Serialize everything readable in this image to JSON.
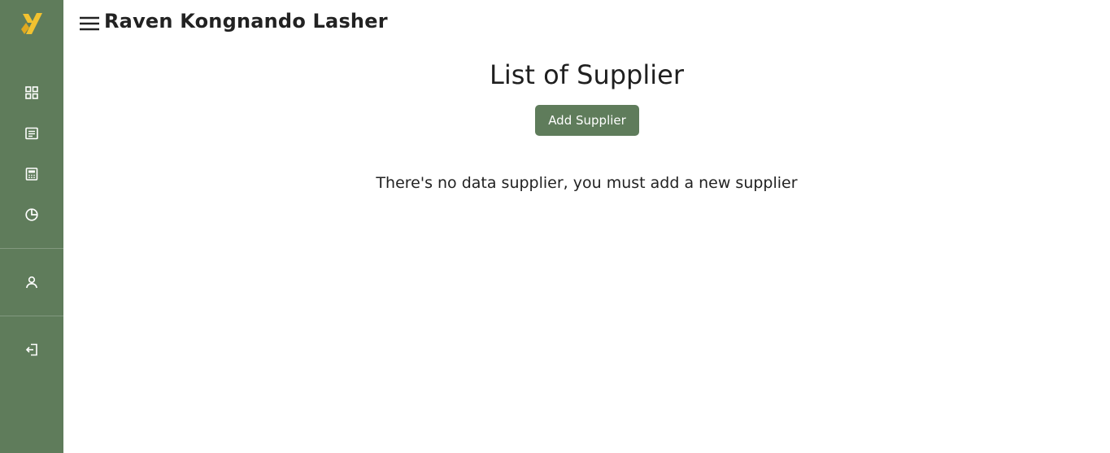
{
  "header": {
    "title": "Raven Kongnando Lasher"
  },
  "sidebar": {
    "logo": "x-logo",
    "items": [
      {
        "icon": "dashboard-grid-icon"
      },
      {
        "icon": "document-list-icon"
      },
      {
        "icon": "calculator-icon"
      },
      {
        "icon": "pie-chart-icon"
      },
      {
        "icon": "user-icon"
      },
      {
        "icon": "logout-icon"
      }
    ]
  },
  "main": {
    "page_title": "List of Supplier",
    "add_button_label": "Add Supplier",
    "empty_message": "There's no data supplier, you must add a new supplier"
  },
  "colors": {
    "sidebar_bg": "#5f7c5b",
    "accent": "#5f7c5b",
    "logo": "#f2c230",
    "icon": "#ffffff"
  }
}
